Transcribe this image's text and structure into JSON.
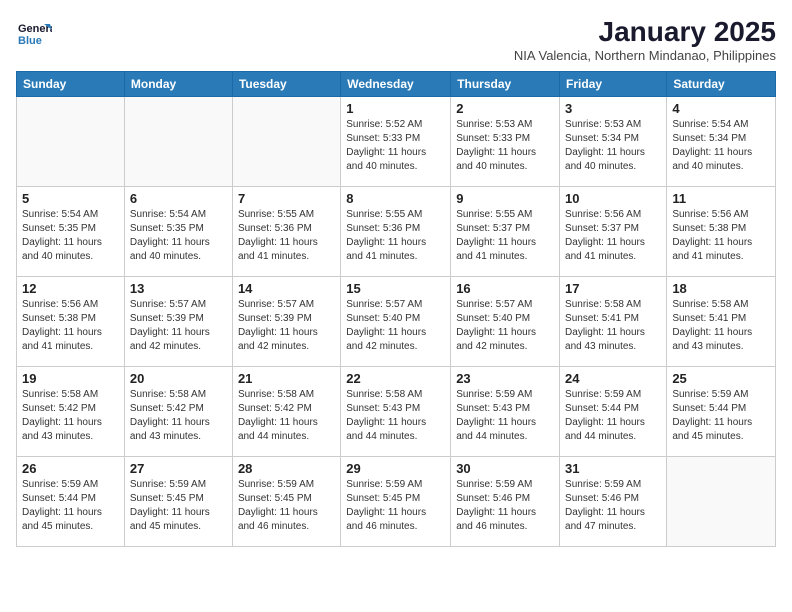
{
  "header": {
    "logo_line1": "General",
    "logo_line2": "Blue",
    "month_year": "January 2025",
    "location": "NIA Valencia, Northern Mindanao, Philippines"
  },
  "weekdays": [
    "Sunday",
    "Monday",
    "Tuesday",
    "Wednesday",
    "Thursday",
    "Friday",
    "Saturday"
  ],
  "weeks": [
    [
      {
        "day": "",
        "sunrise": "",
        "sunset": "",
        "daylight": ""
      },
      {
        "day": "",
        "sunrise": "",
        "sunset": "",
        "daylight": ""
      },
      {
        "day": "",
        "sunrise": "",
        "sunset": "",
        "daylight": ""
      },
      {
        "day": "1",
        "sunrise": "Sunrise: 5:52 AM",
        "sunset": "Sunset: 5:33 PM",
        "daylight": "Daylight: 11 hours and 40 minutes."
      },
      {
        "day": "2",
        "sunrise": "Sunrise: 5:53 AM",
        "sunset": "Sunset: 5:33 PM",
        "daylight": "Daylight: 11 hours and 40 minutes."
      },
      {
        "day": "3",
        "sunrise": "Sunrise: 5:53 AM",
        "sunset": "Sunset: 5:34 PM",
        "daylight": "Daylight: 11 hours and 40 minutes."
      },
      {
        "day": "4",
        "sunrise": "Sunrise: 5:54 AM",
        "sunset": "Sunset: 5:34 PM",
        "daylight": "Daylight: 11 hours and 40 minutes."
      }
    ],
    [
      {
        "day": "5",
        "sunrise": "Sunrise: 5:54 AM",
        "sunset": "Sunset: 5:35 PM",
        "daylight": "Daylight: 11 hours and 40 minutes."
      },
      {
        "day": "6",
        "sunrise": "Sunrise: 5:54 AM",
        "sunset": "Sunset: 5:35 PM",
        "daylight": "Daylight: 11 hours and 40 minutes."
      },
      {
        "day": "7",
        "sunrise": "Sunrise: 5:55 AM",
        "sunset": "Sunset: 5:36 PM",
        "daylight": "Daylight: 11 hours and 41 minutes."
      },
      {
        "day": "8",
        "sunrise": "Sunrise: 5:55 AM",
        "sunset": "Sunset: 5:36 PM",
        "daylight": "Daylight: 11 hours and 41 minutes."
      },
      {
        "day": "9",
        "sunrise": "Sunrise: 5:55 AM",
        "sunset": "Sunset: 5:37 PM",
        "daylight": "Daylight: 11 hours and 41 minutes."
      },
      {
        "day": "10",
        "sunrise": "Sunrise: 5:56 AM",
        "sunset": "Sunset: 5:37 PM",
        "daylight": "Daylight: 11 hours and 41 minutes."
      },
      {
        "day": "11",
        "sunrise": "Sunrise: 5:56 AM",
        "sunset": "Sunset: 5:38 PM",
        "daylight": "Daylight: 11 hours and 41 minutes."
      }
    ],
    [
      {
        "day": "12",
        "sunrise": "Sunrise: 5:56 AM",
        "sunset": "Sunset: 5:38 PM",
        "daylight": "Daylight: 11 hours and 41 minutes."
      },
      {
        "day": "13",
        "sunrise": "Sunrise: 5:57 AM",
        "sunset": "Sunset: 5:39 PM",
        "daylight": "Daylight: 11 hours and 42 minutes."
      },
      {
        "day": "14",
        "sunrise": "Sunrise: 5:57 AM",
        "sunset": "Sunset: 5:39 PM",
        "daylight": "Daylight: 11 hours and 42 minutes."
      },
      {
        "day": "15",
        "sunrise": "Sunrise: 5:57 AM",
        "sunset": "Sunset: 5:40 PM",
        "daylight": "Daylight: 11 hours and 42 minutes."
      },
      {
        "day": "16",
        "sunrise": "Sunrise: 5:57 AM",
        "sunset": "Sunset: 5:40 PM",
        "daylight": "Daylight: 11 hours and 42 minutes."
      },
      {
        "day": "17",
        "sunrise": "Sunrise: 5:58 AM",
        "sunset": "Sunset: 5:41 PM",
        "daylight": "Daylight: 11 hours and 43 minutes."
      },
      {
        "day": "18",
        "sunrise": "Sunrise: 5:58 AM",
        "sunset": "Sunset: 5:41 PM",
        "daylight": "Daylight: 11 hours and 43 minutes."
      }
    ],
    [
      {
        "day": "19",
        "sunrise": "Sunrise: 5:58 AM",
        "sunset": "Sunset: 5:42 PM",
        "daylight": "Daylight: 11 hours and 43 minutes."
      },
      {
        "day": "20",
        "sunrise": "Sunrise: 5:58 AM",
        "sunset": "Sunset: 5:42 PM",
        "daylight": "Daylight: 11 hours and 43 minutes."
      },
      {
        "day": "21",
        "sunrise": "Sunrise: 5:58 AM",
        "sunset": "Sunset: 5:42 PM",
        "daylight": "Daylight: 11 hours and 44 minutes."
      },
      {
        "day": "22",
        "sunrise": "Sunrise: 5:58 AM",
        "sunset": "Sunset: 5:43 PM",
        "daylight": "Daylight: 11 hours and 44 minutes."
      },
      {
        "day": "23",
        "sunrise": "Sunrise: 5:59 AM",
        "sunset": "Sunset: 5:43 PM",
        "daylight": "Daylight: 11 hours and 44 minutes."
      },
      {
        "day": "24",
        "sunrise": "Sunrise: 5:59 AM",
        "sunset": "Sunset: 5:44 PM",
        "daylight": "Daylight: 11 hours and 44 minutes."
      },
      {
        "day": "25",
        "sunrise": "Sunrise: 5:59 AM",
        "sunset": "Sunset: 5:44 PM",
        "daylight": "Daylight: 11 hours and 45 minutes."
      }
    ],
    [
      {
        "day": "26",
        "sunrise": "Sunrise: 5:59 AM",
        "sunset": "Sunset: 5:44 PM",
        "daylight": "Daylight: 11 hours and 45 minutes."
      },
      {
        "day": "27",
        "sunrise": "Sunrise: 5:59 AM",
        "sunset": "Sunset: 5:45 PM",
        "daylight": "Daylight: 11 hours and 45 minutes."
      },
      {
        "day": "28",
        "sunrise": "Sunrise: 5:59 AM",
        "sunset": "Sunset: 5:45 PM",
        "daylight": "Daylight: 11 hours and 46 minutes."
      },
      {
        "day": "29",
        "sunrise": "Sunrise: 5:59 AM",
        "sunset": "Sunset: 5:45 PM",
        "daylight": "Daylight: 11 hours and 46 minutes."
      },
      {
        "day": "30",
        "sunrise": "Sunrise: 5:59 AM",
        "sunset": "Sunset: 5:46 PM",
        "daylight": "Daylight: 11 hours and 46 minutes."
      },
      {
        "day": "31",
        "sunrise": "Sunrise: 5:59 AM",
        "sunset": "Sunset: 5:46 PM",
        "daylight": "Daylight: 11 hours and 47 minutes."
      },
      {
        "day": "",
        "sunrise": "",
        "sunset": "",
        "daylight": ""
      }
    ]
  ]
}
